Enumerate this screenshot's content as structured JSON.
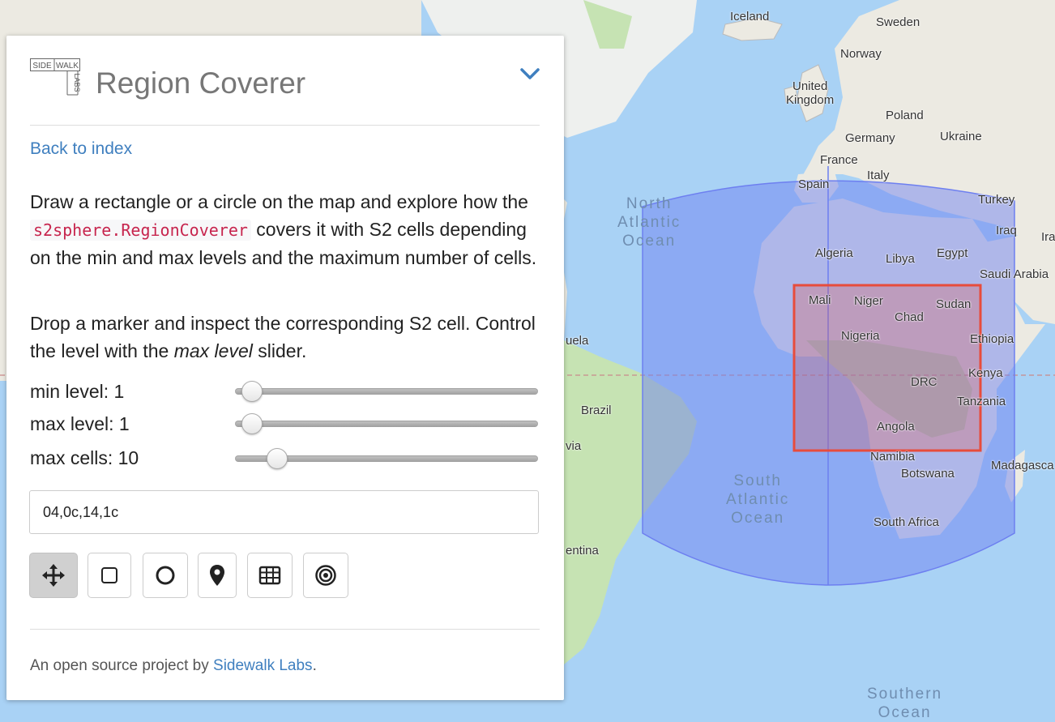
{
  "app": {
    "title": "Region Coverer",
    "logo_text": [
      "SIDE",
      "WALK",
      "LABS"
    ]
  },
  "nav": {
    "back_link": "Back to index"
  },
  "description": {
    "p1_before": "Draw a rectangle or a circle on the map and explore how the",
    "p1_code": "s2sphere.RegionCoverer",
    "p1_after": "covers it with S2 cells depending on the min and max levels and the maximum number of cells.",
    "p2_before": "Drop a marker and inspect the corresponding S2 cell. Control the level with the",
    "p2_em": "max level",
    "p2_after": "slider."
  },
  "controls": {
    "min_level": {
      "label": "min level: 1",
      "value": 1,
      "min": 1,
      "max": 30
    },
    "max_level": {
      "label": "max level: 1",
      "value": 1,
      "min": 1,
      "max": 30
    },
    "max_cells": {
      "label": "max cells: 10",
      "value": 10,
      "min": 1,
      "max": 100
    }
  },
  "cell_ids": {
    "value": "04,0c,14,1c"
  },
  "tools": [
    {
      "name": "pan-tool-button",
      "icon": "move-arrows-icon",
      "active": true
    },
    {
      "name": "rectangle-tool-button",
      "icon": "square-icon",
      "active": false
    },
    {
      "name": "circle-tool-button",
      "icon": "circle-icon",
      "active": false
    },
    {
      "name": "marker-tool-button",
      "icon": "map-pin-icon",
      "active": false
    },
    {
      "name": "grid-tool-button",
      "icon": "grid-icon",
      "active": false
    },
    {
      "name": "target-tool-button",
      "icon": "target-icon",
      "active": false
    }
  ],
  "footer": {
    "text_before": "An open source project by",
    "link": "Sidewalk Labs",
    "text_after": "."
  },
  "map": {
    "country_labels": {
      "iceland": "Iceland",
      "sweden": "Sweden",
      "norway": "Norway",
      "uk1": "United",
      "uk2": "Kingdom",
      "poland": "Poland",
      "germany": "Germany",
      "ukraine": "Ukraine",
      "france": "France",
      "italy": "Italy",
      "spain": "Spain",
      "turkey": "Turkey",
      "iraq": "Iraq",
      "iran": "Ira",
      "algeria": "Algeria",
      "libya": "Libya",
      "egypt": "Egypt",
      "saudi": "Saudi Arabia",
      "mali": "Mali",
      "niger": "Niger",
      "chad": "Chad",
      "sudan": "Sudan",
      "nigeria": "Nigeria",
      "ethiopia": "Ethiopia",
      "drc": "DRC",
      "kenya": "Kenya",
      "tanzania": "Tanzania",
      "angola": "Angola",
      "namibia": "Namibia",
      "botswana": "Botswana",
      "madagascar": "Madagasca",
      "south_africa": "South Africa",
      "brazil": "Brazil",
      "venezuela": "uela",
      "bolivia": "via",
      "argentina": "entina"
    },
    "ocean_labels": {
      "north_atlantic": "North\nAtlantic\nOcean",
      "south_atlantic": "South\nAtlantic\nOcean",
      "southern": "Southern\nOcean"
    },
    "colors": {
      "water": "#a9d2f5",
      "land": "#eceae2",
      "forest": "#c6e3b3",
      "covering": "#6d7ff0",
      "region": "#e74c3c"
    }
  }
}
